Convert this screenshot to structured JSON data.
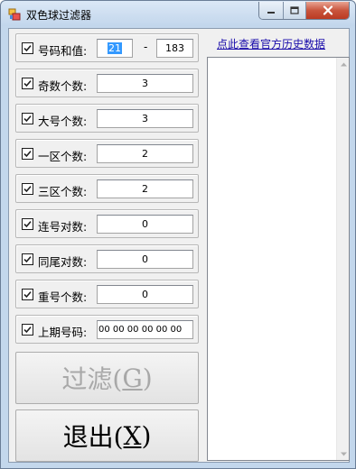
{
  "window": {
    "title": "双色球过滤器",
    "icon": "app-icon"
  },
  "filters": {
    "sum": {
      "label": "号码和值:",
      "checked": true,
      "min": "21",
      "dash": "-",
      "max": "183"
    },
    "odd_count": {
      "label": "奇数个数:",
      "checked": true,
      "value": "3"
    },
    "big_count": {
      "label": "大号个数:",
      "checked": true,
      "value": "3"
    },
    "zone1_count": {
      "label": "一区个数:",
      "checked": true,
      "value": "2"
    },
    "zone3_count": {
      "label": "三区个数:",
      "checked": true,
      "value": "2"
    },
    "consecutive_pairs": {
      "label": "连号对数:",
      "checked": true,
      "value": "0"
    },
    "same_tail_pairs": {
      "label": "同尾对数:",
      "checked": true,
      "value": "0"
    },
    "repeat_count": {
      "label": "重号个数:",
      "checked": true,
      "value": "0"
    },
    "last_draw": {
      "label": "上期号码:",
      "checked": true,
      "value": "00 00 00 00 00 00"
    }
  },
  "buttons": {
    "filter": {
      "text": "过滤(",
      "key": "G",
      "close": ")",
      "enabled": false
    },
    "exit": {
      "text": "退出(",
      "key": "X",
      "close": ")",
      "enabled": true
    }
  },
  "history_link": "点此查看官方历史数据",
  "results": [],
  "colors": {
    "window_frame": "#c3d7ec",
    "client_bg": "#f0f0f0",
    "selection": "#3399ff",
    "link": "#1a0dab",
    "close_button": "#c9553d"
  }
}
